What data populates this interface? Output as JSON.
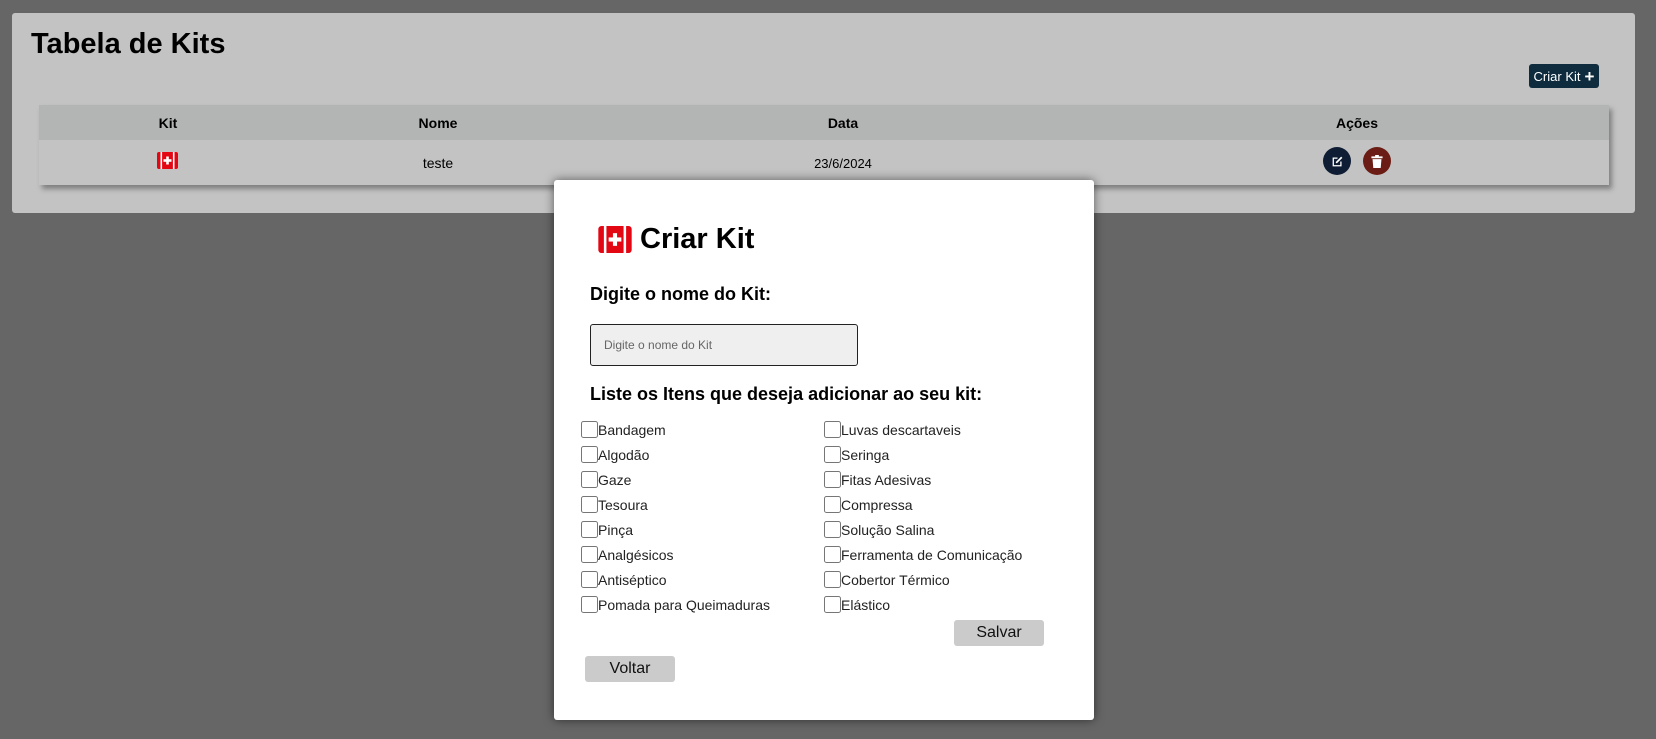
{
  "page": {
    "title": "Tabela de Kits"
  },
  "toolbar": {
    "create_label": "Criar Kit",
    "create_icon": "plus-icon"
  },
  "table": {
    "headers": [
      "Kit",
      "Nome",
      "Data",
      "Ações"
    ],
    "rows": [
      {
        "icon": "first-aid-kit-icon",
        "nome": "teste",
        "data": "23/6/2024",
        "actions": [
          "edit-icon",
          "trash-icon"
        ]
      }
    ]
  },
  "modal": {
    "title": "Criar Kit",
    "title_icon": "first-aid-kit-icon",
    "name_label": "Digite o nome do Kit:",
    "name_placeholder": "Digite o nome do Kit",
    "name_value": "",
    "items_label": "Liste os Itens que deseja adicionar ao seu kit:",
    "items_left": [
      "Bandagem",
      "Algodão",
      "Gaze",
      "Tesoura",
      "Pinça",
      "Analgésicos",
      "Antiséptico",
      "Pomada para Queimaduras"
    ],
    "items_right": [
      "Luvas descartaveis",
      "Seringa",
      "Fitas Adesivas",
      "Compressa",
      "Solução Salina",
      "Ferramenta de Comunicação",
      "Cobertor Térmico",
      "Elástico"
    ],
    "save_label": "Salvar",
    "back_label": "Voltar"
  },
  "colors": {
    "overlay": "#666666",
    "panel": "#c3c3c3",
    "table_header": "#b3b4b4",
    "primary_button": "#0e2c3e",
    "edit_button": "#0e1d33",
    "delete_button": "#6b1d15",
    "kit_red": "#e30613"
  }
}
